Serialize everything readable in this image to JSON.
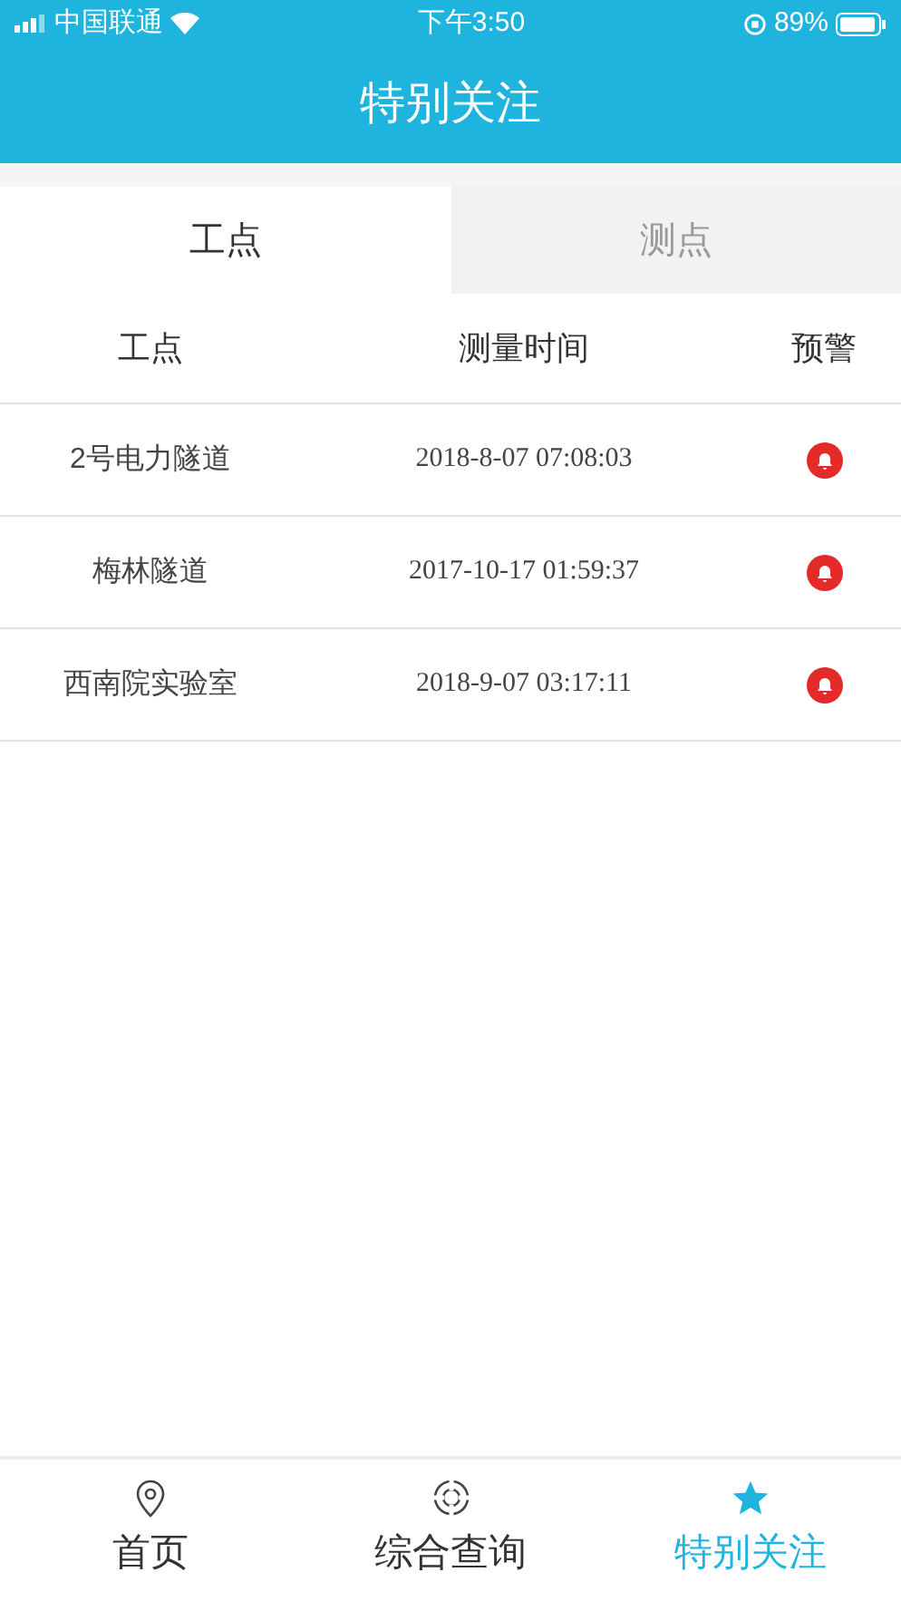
{
  "status_bar": {
    "carrier": "中国联通",
    "time": "下午3:50",
    "battery": "89%"
  },
  "header": {
    "title": "特别关注"
  },
  "tabs": [
    {
      "label": "工点",
      "selected": true
    },
    {
      "label": "测点",
      "selected": false
    }
  ],
  "table": {
    "columns": [
      "工点",
      "测量时间",
      "预警"
    ],
    "rows": [
      {
        "site": "2号电力隧道",
        "time": "2018-8-07 07:08:03",
        "alert": true
      },
      {
        "site": "梅林隧道",
        "time": "2017-10-17 01:59:37",
        "alert": true
      },
      {
        "site": "西南院实验室",
        "time": "2018-9-07 03:17:11",
        "alert": true
      }
    ]
  },
  "bottom_nav": [
    {
      "label": "首页",
      "kind": "pin",
      "selected": false
    },
    {
      "label": "综合查询",
      "kind": "query",
      "selected": false
    },
    {
      "label": "特别关注",
      "kind": "star",
      "selected": true
    }
  ]
}
